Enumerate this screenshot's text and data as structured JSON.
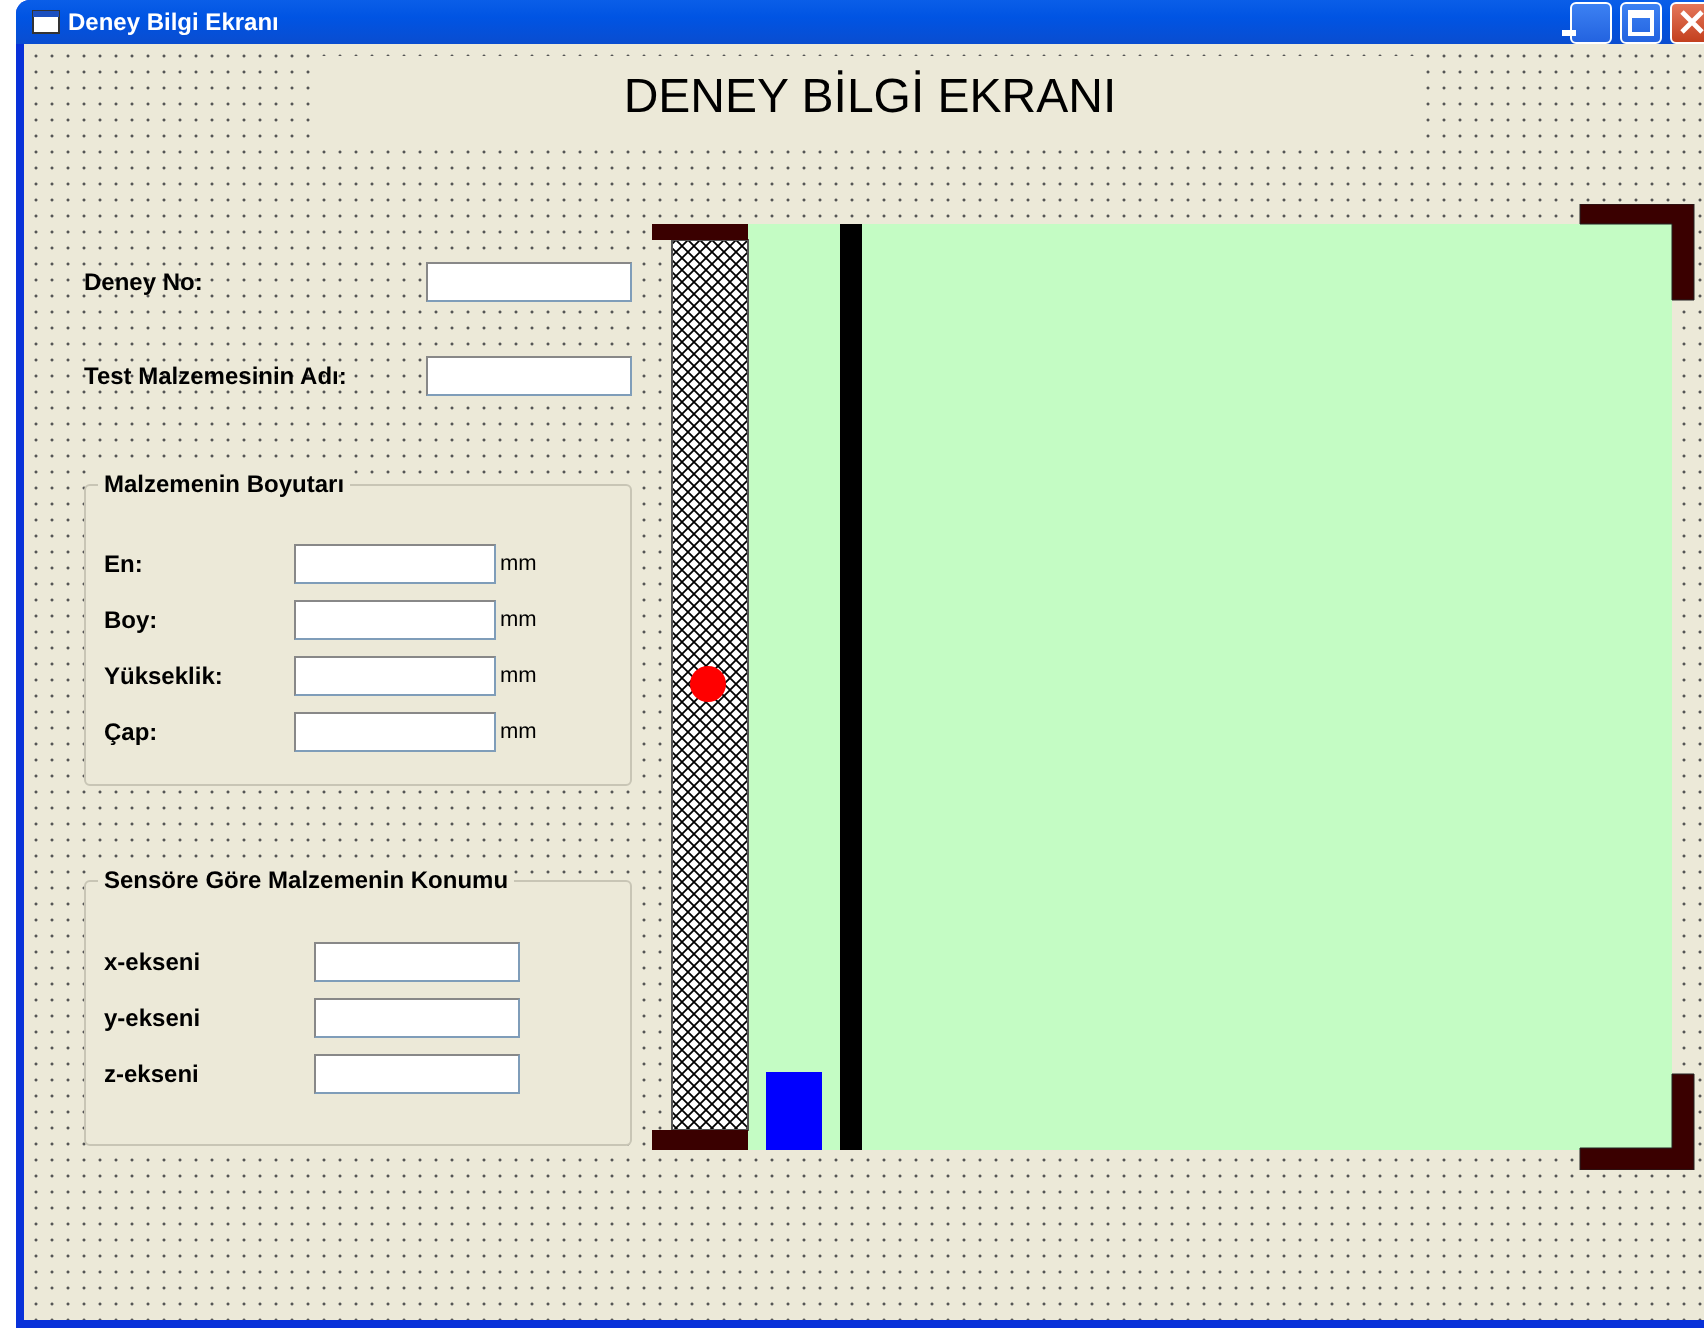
{
  "window": {
    "title": "Deney Bilgi Ekranı"
  },
  "heading": "DENEY BİLGİ EKRANI",
  "fields": [
    {
      "label": "Deney No:"
    },
    {
      "label": "Test Malzemesinin Adı:"
    }
  ],
  "groups": [
    {
      "title": "Malzemenin Boyutarı",
      "rows": [
        {
          "label": "En:",
          "unit": "mm"
        },
        {
          "label": "Boy:",
          "unit": "mm"
        },
        {
          "label": "Yükseklik:",
          "unit": "mm"
        },
        {
          "label": "Çap:",
          "unit": "mm"
        }
      ]
    },
    {
      "title": "Sensöre Göre Malzemenin Konumu",
      "rows": [
        {
          "label": "x-ekseni"
        },
        {
          "label": "y-ekseni"
        },
        {
          "label": "z-ekseni"
        }
      ]
    }
  ]
}
